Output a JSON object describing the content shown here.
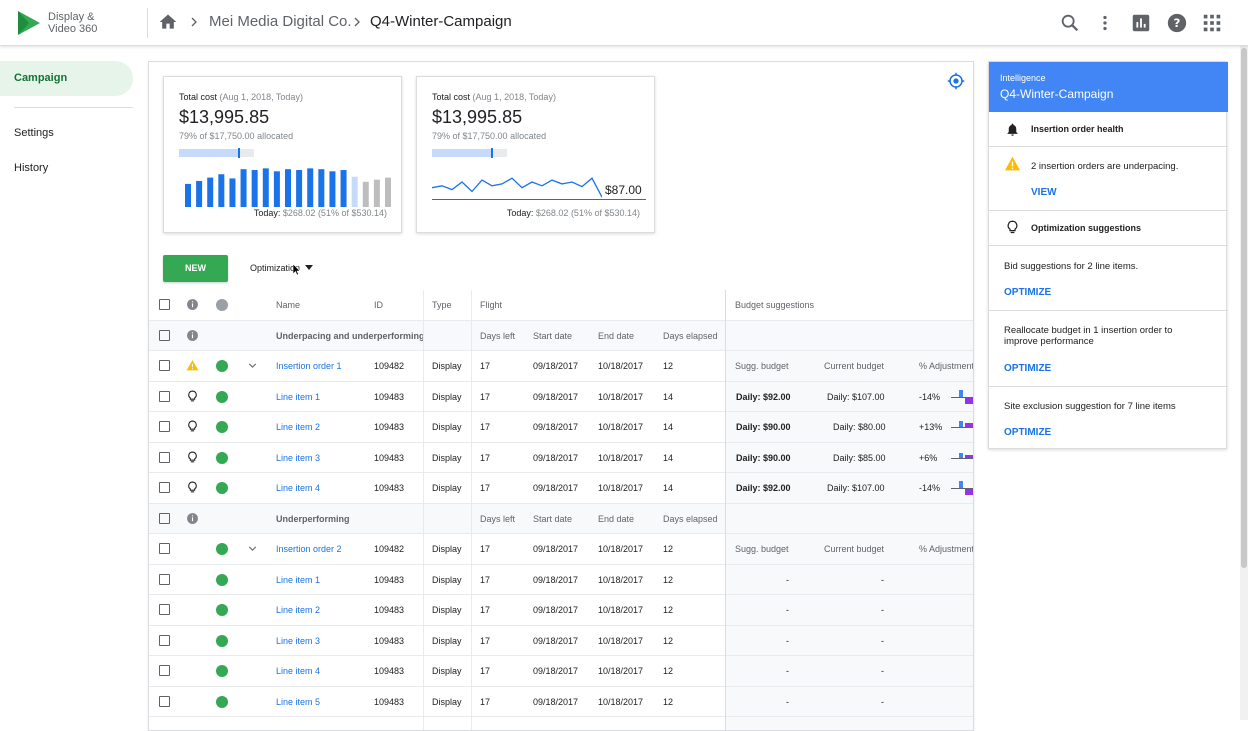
{
  "app": {
    "brand_line1": "Display &",
    "brand_line2": "Video 360"
  },
  "breadcrumb": {
    "advertiser": "Mei Media Digital Co.",
    "campaign": "Q4-Winter-Campaign"
  },
  "toolbar": {
    "icons": [
      "search-icon",
      "more-vert-icon",
      "reports-icon",
      "help-icon",
      "apps-icon"
    ]
  },
  "sidebar": {
    "items": [
      {
        "label": "Campaign",
        "active": true
      },
      {
        "label": "Settings"
      },
      {
        "label": "History"
      }
    ]
  },
  "cards": [
    {
      "label": "Total cost",
      "range": "(Aug 1, 2018, Today)",
      "value": "$13,995.85",
      "allocated": "79% of $17,750.00 allocated",
      "budget_fraction": 0.79,
      "today_label": "Today:",
      "today_value": "$268.02 (51% of $530.14)",
      "bars": [
        0.55,
        0.62,
        0.7,
        0.78,
        0.68,
        0.9,
        0.88,
        0.92,
        0.85,
        0.9,
        0.88,
        0.92,
        0.9,
        0.85,
        0.88,
        0.72,
        0.6,
        0.65,
        0.7
      ]
    },
    {
      "label": "Total cost",
      "range": "(Aug 1, 2018, Today)",
      "value": "$13,995.85",
      "allocated": "79% of $17,750.00 allocated",
      "budget_fraction": 0.79,
      "today_label": "Today:",
      "today_value": "$268.02 (51% of $530.14)",
      "spark_value": "$87.00",
      "spark": [
        0.35,
        0.4,
        0.3,
        0.5,
        0.25,
        0.55,
        0.4,
        0.45,
        0.6,
        0.35,
        0.5,
        0.4,
        0.55,
        0.45,
        0.5,
        0.38,
        0.6,
        0.1
      ]
    }
  ],
  "actions": {
    "new_label": "NEW",
    "optimization_label": "Optimization"
  },
  "table": {
    "headers": {
      "name": "Name",
      "id": "ID",
      "type": "Type",
      "flight": "Flight",
      "budget": "Budget suggestions"
    },
    "sub_headers": {
      "days_left": "Days left",
      "start": "Start date",
      "end": "End date",
      "elapsed": "Days elapsed",
      "sugg": "Sugg. budget",
      "current": "Current budget",
      "adj": "% Adjustment"
    },
    "group1": {
      "label": "Underpacing and underperforming"
    },
    "io1": {
      "name": "Insertion order 1",
      "id": "109482",
      "type": "Display",
      "days_left": "17",
      "start": "09/18/2017",
      "end": "10/18/2017",
      "elapsed": "12"
    },
    "io1_items": [
      {
        "name": "Line item 1",
        "id": "109483",
        "type": "Display",
        "days_left": "17",
        "start": "09/18/2017",
        "end": "10/18/2017",
        "elapsed": "14",
        "sugg": "Daily: $92.00",
        "current": "Daily: $107.00",
        "adj": "-14%"
      },
      {
        "name": "Line item 2",
        "id": "109483",
        "type": "Display",
        "days_left": "17",
        "start": "09/18/2017",
        "end": "10/18/2017",
        "elapsed": "14",
        "sugg": "Daily: $90.00",
        "current": "Daily: $80.00",
        "adj": "+13%"
      },
      {
        "name": "Line item 3",
        "id": "109483",
        "type": "Display",
        "days_left": "17",
        "start": "09/18/2017",
        "end": "10/18/2017",
        "elapsed": "14",
        "sugg": "Daily: $90.00",
        "current": "Daily: $85.00",
        "adj": "+6%"
      },
      {
        "name": "Line item 4",
        "id": "109483",
        "type": "Display",
        "days_left": "17",
        "start": "09/18/2017",
        "end": "10/18/2017",
        "elapsed": "14",
        "sugg": "Daily: $92.00",
        "current": "Daily: $107.00",
        "adj": "-14%"
      }
    ],
    "group2": {
      "label": "Underperforming"
    },
    "io2": {
      "name": "Insertion order 2",
      "id": "109482",
      "type": "Display",
      "days_left": "17",
      "start": "09/18/2017",
      "end": "10/18/2017",
      "elapsed": "12"
    },
    "io2_items": [
      {
        "name": "Line item 1",
        "id": "109483",
        "type": "Display",
        "days_left": "17",
        "start": "09/18/2017",
        "end": "10/18/2017",
        "elapsed": "12",
        "sugg": "-",
        "current": "-"
      },
      {
        "name": "Line item 2",
        "id": "109483",
        "type": "Display",
        "days_left": "17",
        "start": "09/18/2017",
        "end": "10/18/2017",
        "elapsed": "12",
        "sugg": "-",
        "current": "-"
      },
      {
        "name": "Line item 3",
        "id": "109483",
        "type": "Display",
        "days_left": "17",
        "start": "09/18/2017",
        "end": "10/18/2017",
        "elapsed": "12",
        "sugg": "-",
        "current": "-"
      },
      {
        "name": "Line item 4",
        "id": "109483",
        "type": "Display",
        "days_left": "17",
        "start": "09/18/2017",
        "end": "10/18/2017",
        "elapsed": "12",
        "sugg": "-",
        "current": "-"
      },
      {
        "name": "Line item 5",
        "id": "109483",
        "type": "Display",
        "days_left": "17",
        "start": "09/18/2017",
        "end": "10/18/2017",
        "elapsed": "12",
        "sugg": "-",
        "current": "-"
      }
    ]
  },
  "intelligence": {
    "kicker": "Intelligence",
    "title": "Q4-Winter-Campaign",
    "io_health": {
      "title": "Insertion order health",
      "message": "2 insertion orders are underpacing.",
      "action": "VIEW"
    },
    "optimization": {
      "title": "Optimization suggestions",
      "items": [
        {
          "text": "Bid suggestions for 2 line items.",
          "action": "OPTIMIZE"
        },
        {
          "text": "Reallocate budget in 1 insertion order to improve performance",
          "action": "OPTIMIZE"
        },
        {
          "text": "Site exclusion suggestion for 7 line items",
          "action": "OPTIMIZE"
        }
      ]
    }
  },
  "colors": {
    "brand_green": "#34a853",
    "link_blue": "#1a73e8",
    "header_blue": "#4285f4",
    "warning": "#fbbc04"
  }
}
